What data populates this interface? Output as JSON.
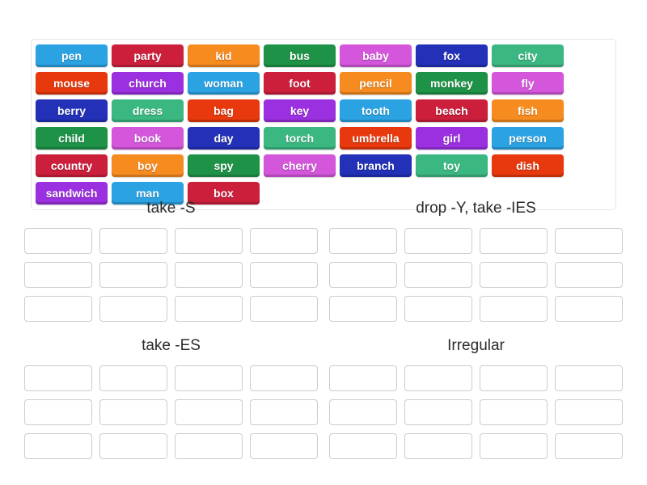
{
  "activity": {
    "type": "group-sort",
    "tile_pool_name": "word-tile-pool"
  },
  "tiles": [
    {
      "label": "pen",
      "color": "#2BA3E3"
    },
    {
      "label": "party",
      "color": "#CC1F3C"
    },
    {
      "label": "kid",
      "color": "#F68B1F"
    },
    {
      "label": "bus",
      "color": "#1E9348"
    },
    {
      "label": "baby",
      "color": "#D356DB"
    },
    {
      "label": "fox",
      "color": "#2231B8"
    },
    {
      "label": "city",
      "color": "#3BB882"
    },
    {
      "label": "mouse",
      "color": "#E8380D"
    },
    {
      "label": "church",
      "color": "#9B30E0"
    },
    {
      "label": "woman",
      "color": "#2BA3E3"
    },
    {
      "label": "foot",
      "color": "#CC1F3C"
    },
    {
      "label": "pencil",
      "color": "#F68B1F"
    },
    {
      "label": "monkey",
      "color": "#1E9348"
    },
    {
      "label": "fly",
      "color": "#D356DB"
    },
    {
      "label": "berry",
      "color": "#2231B8"
    },
    {
      "label": "dress",
      "color": "#3BB882"
    },
    {
      "label": "bag",
      "color": "#E8380D"
    },
    {
      "label": "key",
      "color": "#9B30E0"
    },
    {
      "label": "tooth",
      "color": "#2BA3E3"
    },
    {
      "label": "beach",
      "color": "#CC1F3C"
    },
    {
      "label": "fish",
      "color": "#F68B1F"
    },
    {
      "label": "child",
      "color": "#1E9348"
    },
    {
      "label": "book",
      "color": "#D356DB"
    },
    {
      "label": "day",
      "color": "#2231B8"
    },
    {
      "label": "torch",
      "color": "#3BB882"
    },
    {
      "label": "umbrella",
      "color": "#E8380D"
    },
    {
      "label": "girl",
      "color": "#9B30E0"
    },
    {
      "label": "person",
      "color": "#2BA3E3"
    },
    {
      "label": "country",
      "color": "#CC1F3C"
    },
    {
      "label": "boy",
      "color": "#F68B1F"
    },
    {
      "label": "spy",
      "color": "#1E9348"
    },
    {
      "label": "cherry",
      "color": "#D356DB"
    },
    {
      "label": "branch",
      "color": "#2231B8"
    },
    {
      "label": "toy",
      "color": "#3BB882"
    },
    {
      "label": "dish",
      "color": "#E8380D"
    },
    {
      "label": "sandwich",
      "color": "#9B30E0"
    },
    {
      "label": "man",
      "color": "#2BA3E3"
    },
    {
      "label": "box",
      "color": "#CC1F3C"
    }
  ],
  "groups": [
    {
      "title": "take -S",
      "slot_count": 12,
      "slots": [
        "",
        "",
        "",
        "",
        "",
        "",
        "",
        "",
        "",
        "",
        "",
        ""
      ]
    },
    {
      "title": "drop -Y, take -IES",
      "slot_count": 12,
      "slots": [
        "",
        "",
        "",
        "",
        "",
        "",
        "",
        "",
        "",
        "",
        "",
        ""
      ]
    },
    {
      "title": "take -ES",
      "slot_count": 12,
      "slots": [
        "",
        "",
        "",
        "",
        "",
        "",
        "",
        "",
        "",
        "",
        "",
        ""
      ]
    },
    {
      "title": "Irregular",
      "slot_count": 12,
      "slots": [
        "",
        "",
        "",
        "",
        "",
        "",
        "",
        "",
        "",
        "",
        "",
        ""
      ]
    }
  ]
}
